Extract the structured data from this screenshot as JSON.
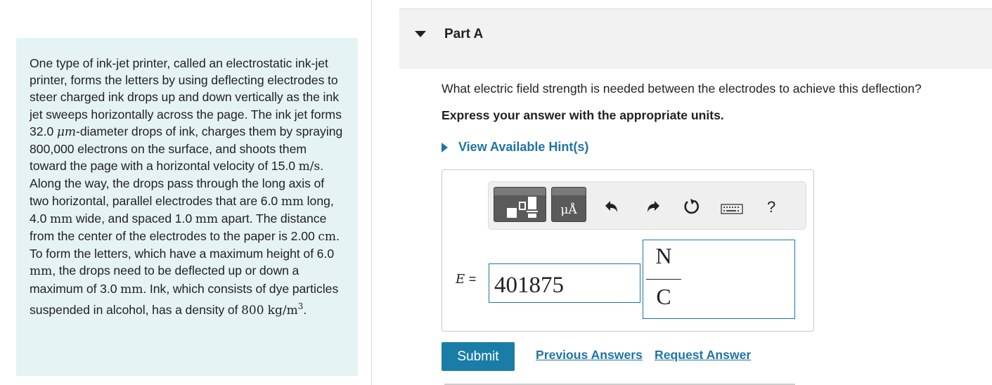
{
  "problem": {
    "t1": "One type of ink-jet printer, called an electrostatic ink-jet printer, forms the letters by using deflecting electrodes to steer charged ink drops up and down vertically as the ink jet sweeps horizontally across the page. The ink jet forms 32.0 ",
    "m1": "μm",
    "t2": "-diameter drops of ink, charges them by spraying 800,000 electrons on the surface, and shoots them toward the page with a horizontal velocity of 15.0 ",
    "m2": "m/s",
    "t3": ". Along the way, the drops pass through the long axis of two horizontal, parallel electrodes that are 6.0 ",
    "m3": "mm",
    "t4": " long, 4.0 ",
    "m4": "mm",
    "t5": " wide, and spaced 1.0 ",
    "m5": "mm",
    "t6": " apart. The distance from the center of the electrodes to the paper is 2.00 ",
    "m6": "cm",
    "t7": ". To form the letters, which have a maximum height of 6.0 ",
    "m7": "mm",
    "t8": ", the drops need to be deflected up or down a maximum of 3.0 ",
    "m8": "mm",
    "t9": ". Ink, which consists of dye particles suspended in alcohol, has a density of ",
    "m9": "800 kg/m",
    "m9_sup": "3",
    "t10": "."
  },
  "part": {
    "title": "Part A"
  },
  "question": "What electric field strength is needed between the electrodes to achieve this deflection?",
  "instruction": "Express your answer with the appropriate units.",
  "hint_label": "View Available Hint(s)",
  "toolbar": {
    "icons": [
      "templates-icon",
      "units-icon",
      "undo-icon",
      "redo-icon",
      "reset-icon",
      "keyboard-icon",
      "help-icon"
    ],
    "units_glyph": "μÅ",
    "help_label": "?"
  },
  "answer": {
    "variable": "E",
    "equals": "=",
    "value": "401875",
    "unit_numerator": "N",
    "unit_denominator": "C"
  },
  "actions": {
    "submit": "Submit",
    "previous": "Previous Answers",
    "request": "Request Answer"
  },
  "colors": {
    "panel_bg": "#e6f3f4",
    "accent": "#1f74a6",
    "submit_bg": "#1a7da8"
  }
}
